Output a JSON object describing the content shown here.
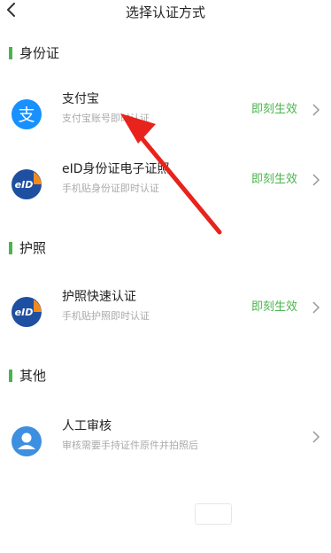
{
  "header": {
    "title": "选择认证方式",
    "back_icon": "chevron-left-icon"
  },
  "sections": [
    {
      "label": "身份证",
      "items": [
        {
          "name": "支付宝",
          "desc": "支付宝账号即时认证",
          "action": "即刻生效",
          "icon": "alipay-icon"
        },
        {
          "name": "eID身份证电子证照",
          "desc": "手机贴身份证即时认证",
          "action": "即刻生效",
          "icon": "eid-icon"
        }
      ]
    },
    {
      "label": "护照",
      "items": [
        {
          "name": "护照快速认证",
          "desc": "手机贴护照即时认证",
          "action": "即刻生效",
          "icon": "eid-icon"
        }
      ]
    },
    {
      "label": "其他",
      "items": [
        {
          "name": "人工审核",
          "desc": "审核需要手持证件原件并拍照后",
          "icon": "person-icon"
        }
      ]
    }
  ],
  "colors": {
    "accent_green": "#49b54b",
    "alipay_blue": "#1890ff",
    "eid_blue": "#1e4fa0",
    "eid_orange": "#f28a1e",
    "annotation_red": "#e8231c",
    "person_blue": "#3d8fe0"
  }
}
